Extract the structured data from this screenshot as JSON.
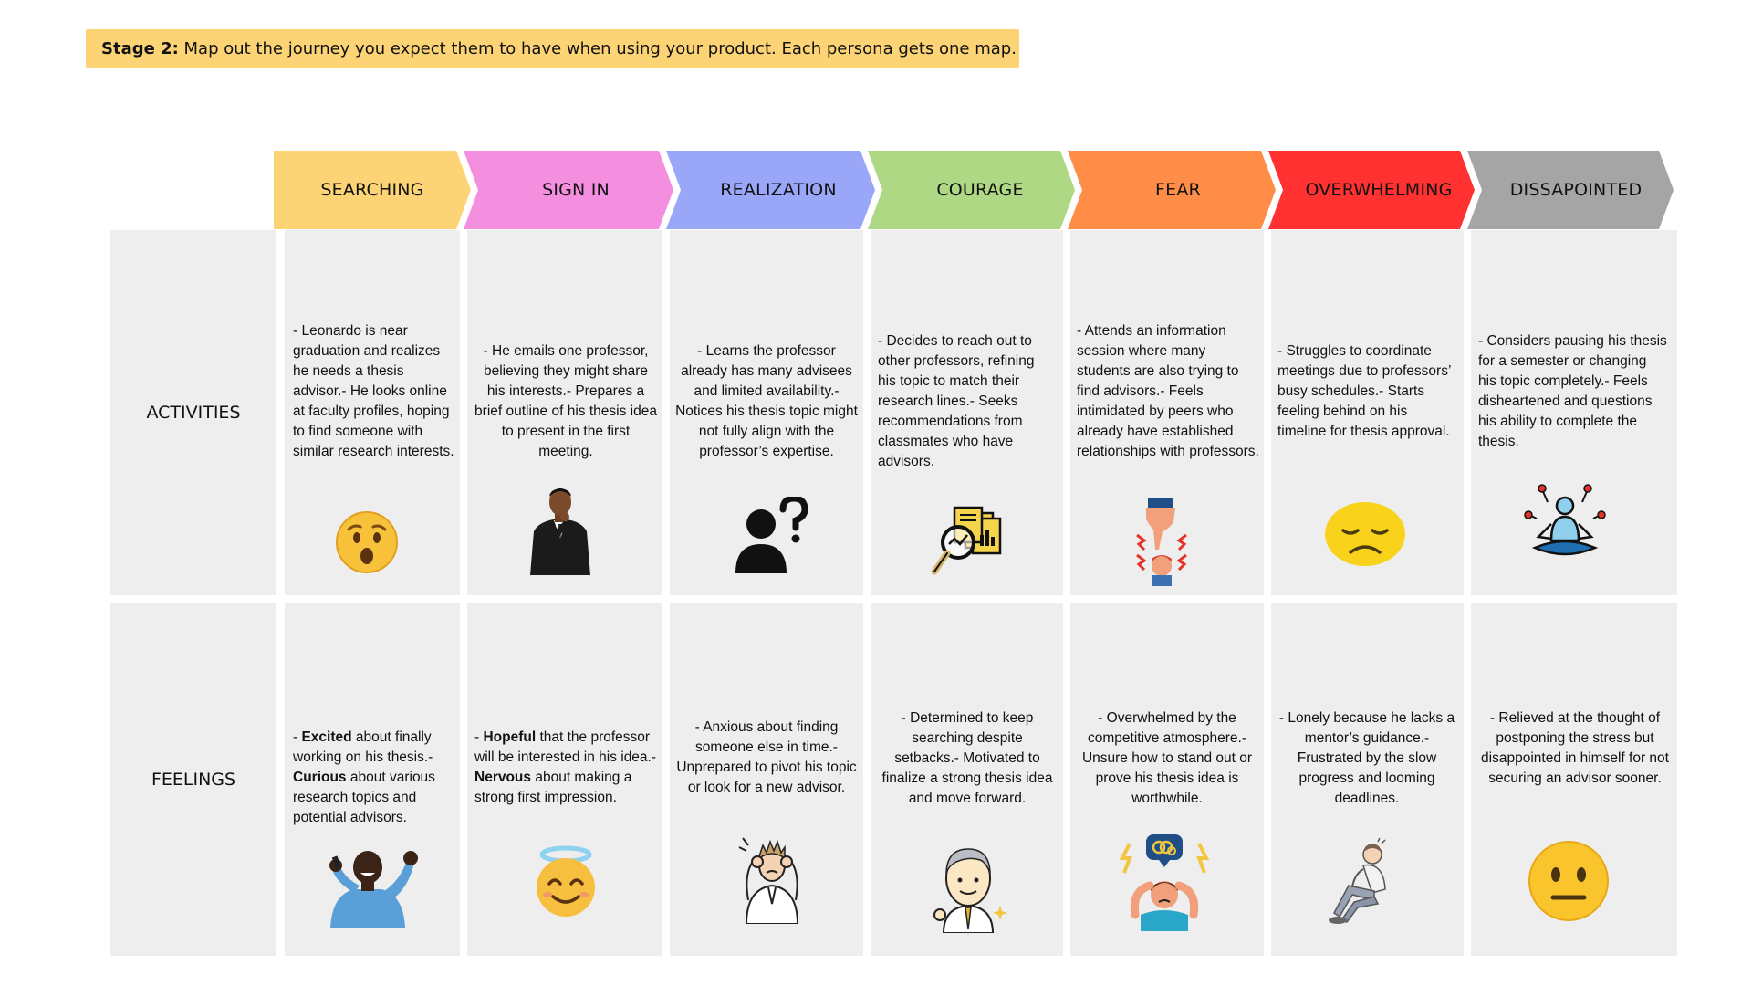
{
  "banner": {
    "prefix": "Stage 2:",
    "text": " Map out the journey you expect them to have when using your product. Each persona gets one map."
  },
  "colors": {
    "searching": "#fdd475",
    "sign_in": "#f48fe0",
    "realization": "#9aa7f9",
    "courage": "#aed883",
    "fear": "#ff8c47",
    "overwhelming": "#ff3131",
    "dissapointed": "#a5a5a5",
    "cell_bg": "#eeeeee"
  },
  "rows": {
    "activities": "ACTIVITIES",
    "feelings": "FEELINGS"
  },
  "stages": [
    {
      "label": "SEARCHING",
      "activity": "- Leonardo is near graduation and realizes he needs a thesis advisor.- He looks online at faculty profiles, hoping to find someone with similar research interests.",
      "activity_icon": "surprised-face-icon",
      "feeling": [
        {
          "t": "- ",
          "b": false
        },
        {
          "t": "Excited",
          "b": true
        },
        {
          "t": " about finally working on his thesis.- ",
          "b": false
        },
        {
          "t": "Curious",
          "b": true
        },
        {
          "t": " about various research topics and potential advisors.",
          "b": false
        }
      ],
      "feeling_icon": "excited-man-phone-icon"
    },
    {
      "label": "SIGN IN",
      "activity": "- He emails one professor, believing they might share his interests.- Prepares a brief outline of his thesis idea to present in the first meeting.",
      "activity_icon": "thinking-man-suit-icon",
      "feeling": [
        {
          "t": "- ",
          "b": false
        },
        {
          "t": "Hopeful",
          "b": true
        },
        {
          "t": " that the professor will be interested in his idea.- ",
          "b": false
        },
        {
          "t": "Nervous",
          "b": true
        },
        {
          "t": " about making a strong first impression.",
          "b": false
        }
      ],
      "feeling_icon": "halo-smiling-face-icon"
    },
    {
      "label": "REALIZATION",
      "activity": "- Learns the professor already has many advisees and limited availability.- Notices his thesis topic might not fully align with the professor’s expertise.",
      "activity_icon": "person-question-icon",
      "feeling": [
        {
          "t": "- Anxious about finding someone else in time.- Unprepared to pivot his topic or look for a new advisor.",
          "b": false
        }
      ],
      "feeling_icon": "stressed-man-icon"
    },
    {
      "label": "COURAGE",
      "activity": "- Decides to reach out to other professors, refining his topic to match their research lines.- Seeks recommendations from classmates who have advisors.",
      "activity_icon": "magnifier-documents-icon",
      "feeling": [
        {
          "t": "- Determined to keep searching despite setbacks.- Motivated to finalize a strong thesis idea and move forward.",
          "b": false
        }
      ],
      "feeling_icon": "confident-man-icon"
    },
    {
      "label": "FEAR",
      "activity": "- Attends an information session where many students are also trying to find advisors.- Feels intimidated by peers who already have established relationships with professors.",
      "activity_icon": "pointing-intimidation-icon",
      "feeling": [
        {
          "t": "- Overwhelmed by the competitive atmosphere.- Unsure how to stand out or prove his thesis idea is worthwhile.",
          "b": false
        }
      ],
      "feeling_icon": "overwhelmed-thoughts-icon"
    },
    {
      "label": "OVERWHELMING",
      "activity": "- Struggles to coordinate meetings due to professors’ busy schedules.- Starts feeling behind on his timeline for thesis approval.",
      "activity_icon": "sad-face-icon",
      "feeling": [
        {
          "t": "- Lonely because he lacks a mentor’s guidance.- Frustrated by the slow progress and looming deadlines.",
          "b": false
        }
      ],
      "feeling_icon": "sitting-sad-man-icon"
    },
    {
      "label": "DISSAPOINTED",
      "activity": "- Considers pausing his thesis for a semester or changing his topic completely.- Feels disheartened and questions his ability to complete the thesis.",
      "activity_icon": "meditation-person-icon",
      "feeling": [
        {
          "t": "- Relieved at the thought of postponing the stress but disappointed in himself for not securing an advisor sooner.",
          "b": false
        }
      ],
      "feeling_icon": "neutral-face-icon"
    }
  ]
}
